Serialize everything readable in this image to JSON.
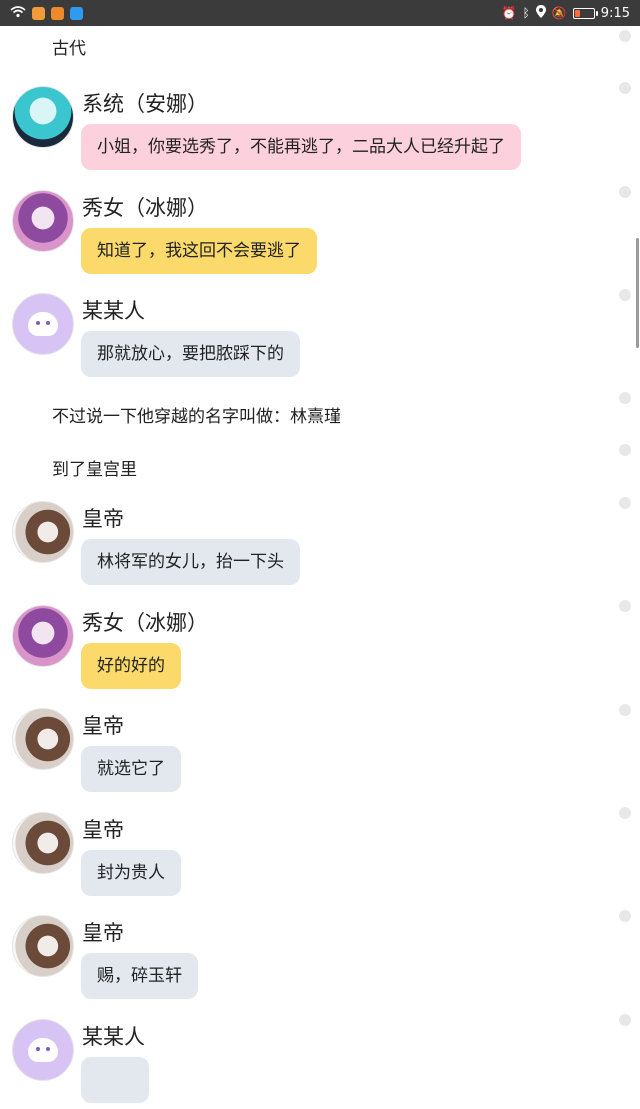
{
  "status_bar": {
    "time": "9:15",
    "left_icons": [
      "wifi-icon",
      "app-orange-icon",
      "app-orange-play-icon",
      "app-blue-search-icon"
    ],
    "right_icons": [
      "alarm-icon",
      "bluetooth-icon",
      "location-icon",
      "mute-icon",
      "battery-icon"
    ],
    "battery_level": 0.3
  },
  "chat": {
    "items": [
      {
        "kind": "narration",
        "text": "古代"
      },
      {
        "kind": "message",
        "sender": "系统（安娜）",
        "text": "小姐，你要选秀了，不能再逃了，二品大人已经升起了",
        "bubble": "pink",
        "avatar": "miku"
      },
      {
        "kind": "message",
        "sender": "秀女（冰娜）",
        "text": "知道了，我这回不会要逃了",
        "bubble": "yellow",
        "avatar": "bingna"
      },
      {
        "kind": "message",
        "sender": "某某人",
        "text": "那就放心，要把脓踩下的",
        "bubble": "gray",
        "avatar": "ghost"
      },
      {
        "kind": "narration",
        "text": "不过说一下他穿越的名字叫做：林熹瑾"
      },
      {
        "kind": "narration",
        "text": "到了皇宫里"
      },
      {
        "kind": "message",
        "sender": "皇帝",
        "text": "林将军的女儿，抬一下头",
        "bubble": "gray",
        "avatar": "emperor"
      },
      {
        "kind": "message",
        "sender": "秀女（冰娜）",
        "text": "好的好的",
        "bubble": "yellow",
        "avatar": "bingna"
      },
      {
        "kind": "message",
        "sender": "皇帝",
        "text": "就选它了",
        "bubble": "gray",
        "avatar": "emperor"
      },
      {
        "kind": "message",
        "sender": "皇帝",
        "text": "封为贵人",
        "bubble": "gray",
        "avatar": "emperor"
      },
      {
        "kind": "message",
        "sender": "皇帝",
        "text": "赐，碎玉轩",
        "bubble": "gray",
        "avatar": "emperor"
      },
      {
        "kind": "message",
        "sender": "某某人",
        "text": "",
        "bubble": "gray",
        "avatar": "ghost"
      }
    ]
  },
  "colors": {
    "status_bar_bg": "#3b3b3b",
    "bubble_pink": "#fcd0dc",
    "bubble_yellow": "#fbd96a",
    "bubble_gray": "#e3e8ef"
  }
}
